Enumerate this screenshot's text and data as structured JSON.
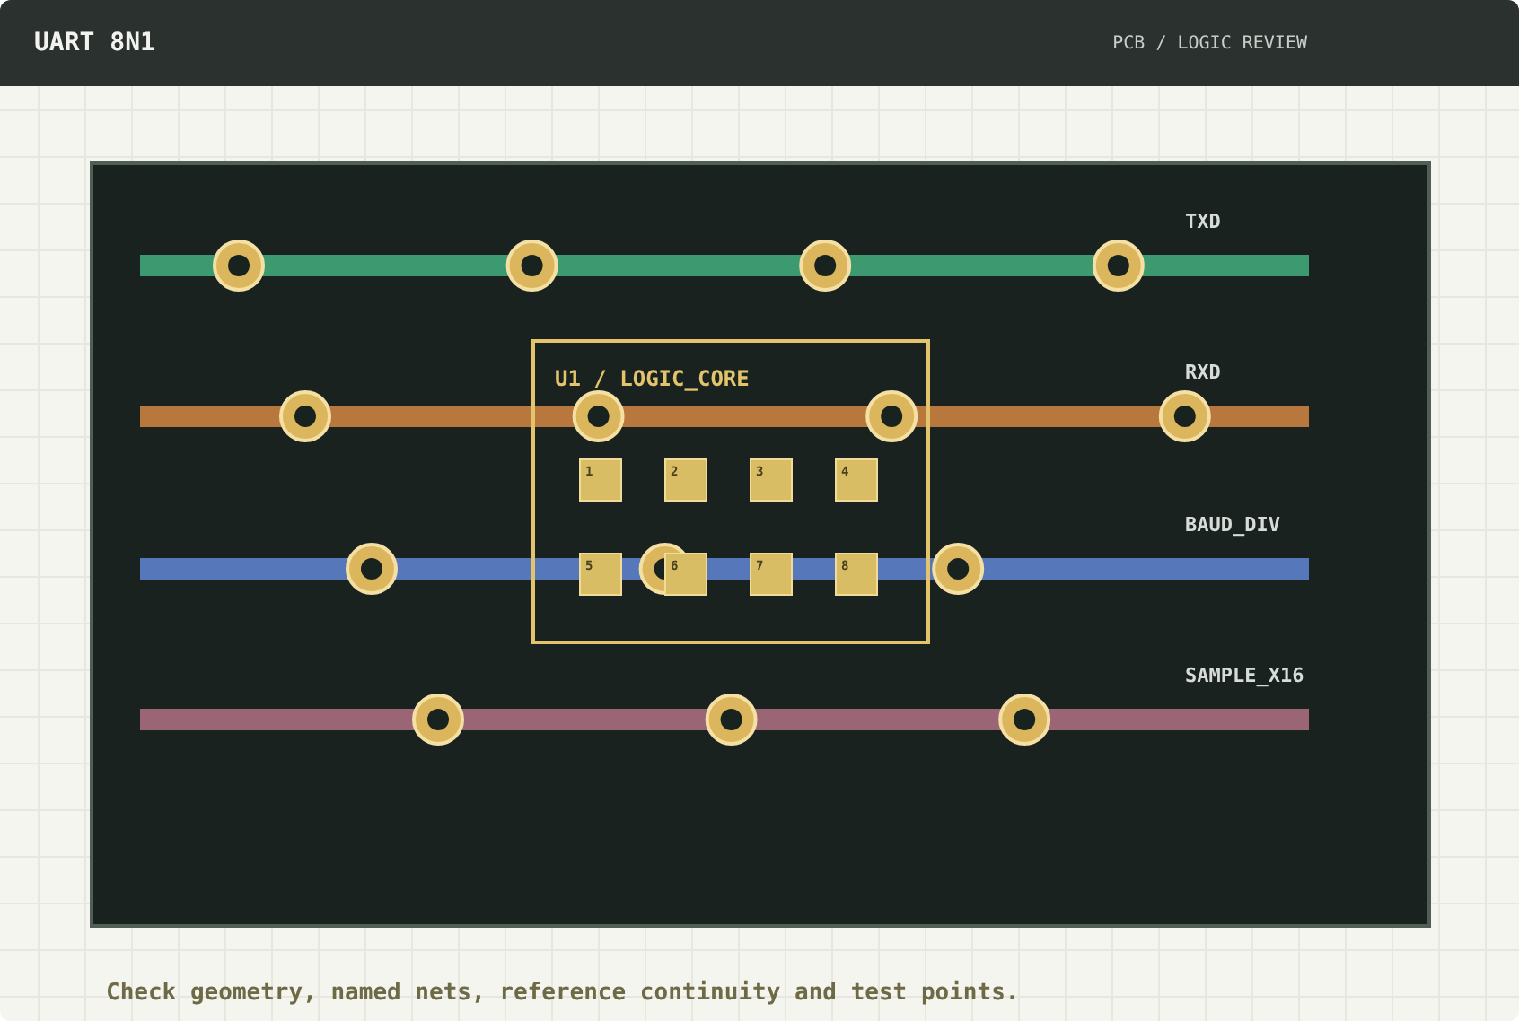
{
  "header": {
    "title": "UART 8N1",
    "subtitle": "PCB / LOGIC REVIEW"
  },
  "nets": [
    {
      "name": "TXD",
      "color": "#3d9a70",
      "vias": [
        {
          "kind": "via"
        },
        {
          "kind": "via"
        },
        {
          "kind": "via"
        },
        {
          "kind": "via"
        }
      ]
    },
    {
      "name": "RXD",
      "color": "#b8773c",
      "vias": [
        {
          "kind": "via"
        },
        {
          "kind": "via"
        },
        {
          "kind": "via"
        },
        {
          "kind": "via"
        }
      ]
    },
    {
      "name": "BAUD_DIV",
      "color": "#5678bb",
      "vias": [
        {
          "kind": "via"
        },
        {
          "kind": "via"
        },
        {
          "kind": "via"
        }
      ]
    },
    {
      "name": "SAMPLE_X16",
      "color": "#9a6575",
      "vias": [
        {
          "kind": "via"
        },
        {
          "kind": "via"
        },
        {
          "kind": "via"
        }
      ]
    }
  ],
  "component": {
    "label": "U1 / LOGIC_CORE",
    "pins": [
      "1",
      "2",
      "3",
      "4",
      "5",
      "6",
      "7",
      "8"
    ]
  },
  "caption": "Check geometry, named nets, reference continuity and test points."
}
